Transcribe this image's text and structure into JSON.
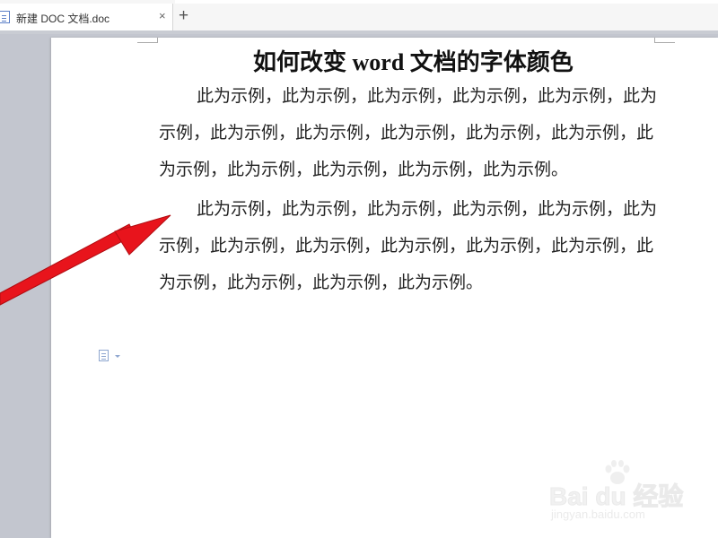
{
  "tabs": [
    {
      "label": "新建 DOC 文档.doc",
      "close": "×",
      "active": true
    }
  ],
  "new_tab_label": "+",
  "document": {
    "title": "如何改变 word 文档的字体颜色",
    "paragraphs": [
      "此为示例，此为示例，此为示例，此为示例，此为示例，此为示例，此为示例，此为示例，此为示例，此为示例，此为示例，此为示例，此为示例，此为示例，此为示例，此为示例。",
      "此为示例，此为示例，此为示例，此为示例，此为示例，此为示例，此为示例，此为示例，此为示例，此为示例，此为示例，此为示例，此为示例，此为示例，此为示例。"
    ]
  },
  "watermark": {
    "brand": "Bai du 经验",
    "url": "jingyan.baidu.com"
  },
  "colors": {
    "annotation_arrow": "#e8141c",
    "workspace_bg": "#c3c6cf",
    "page_bg": "#ffffff"
  },
  "icons": [
    "document-icon",
    "close-icon",
    "plus-icon",
    "paragraph-layout-icon"
  ]
}
